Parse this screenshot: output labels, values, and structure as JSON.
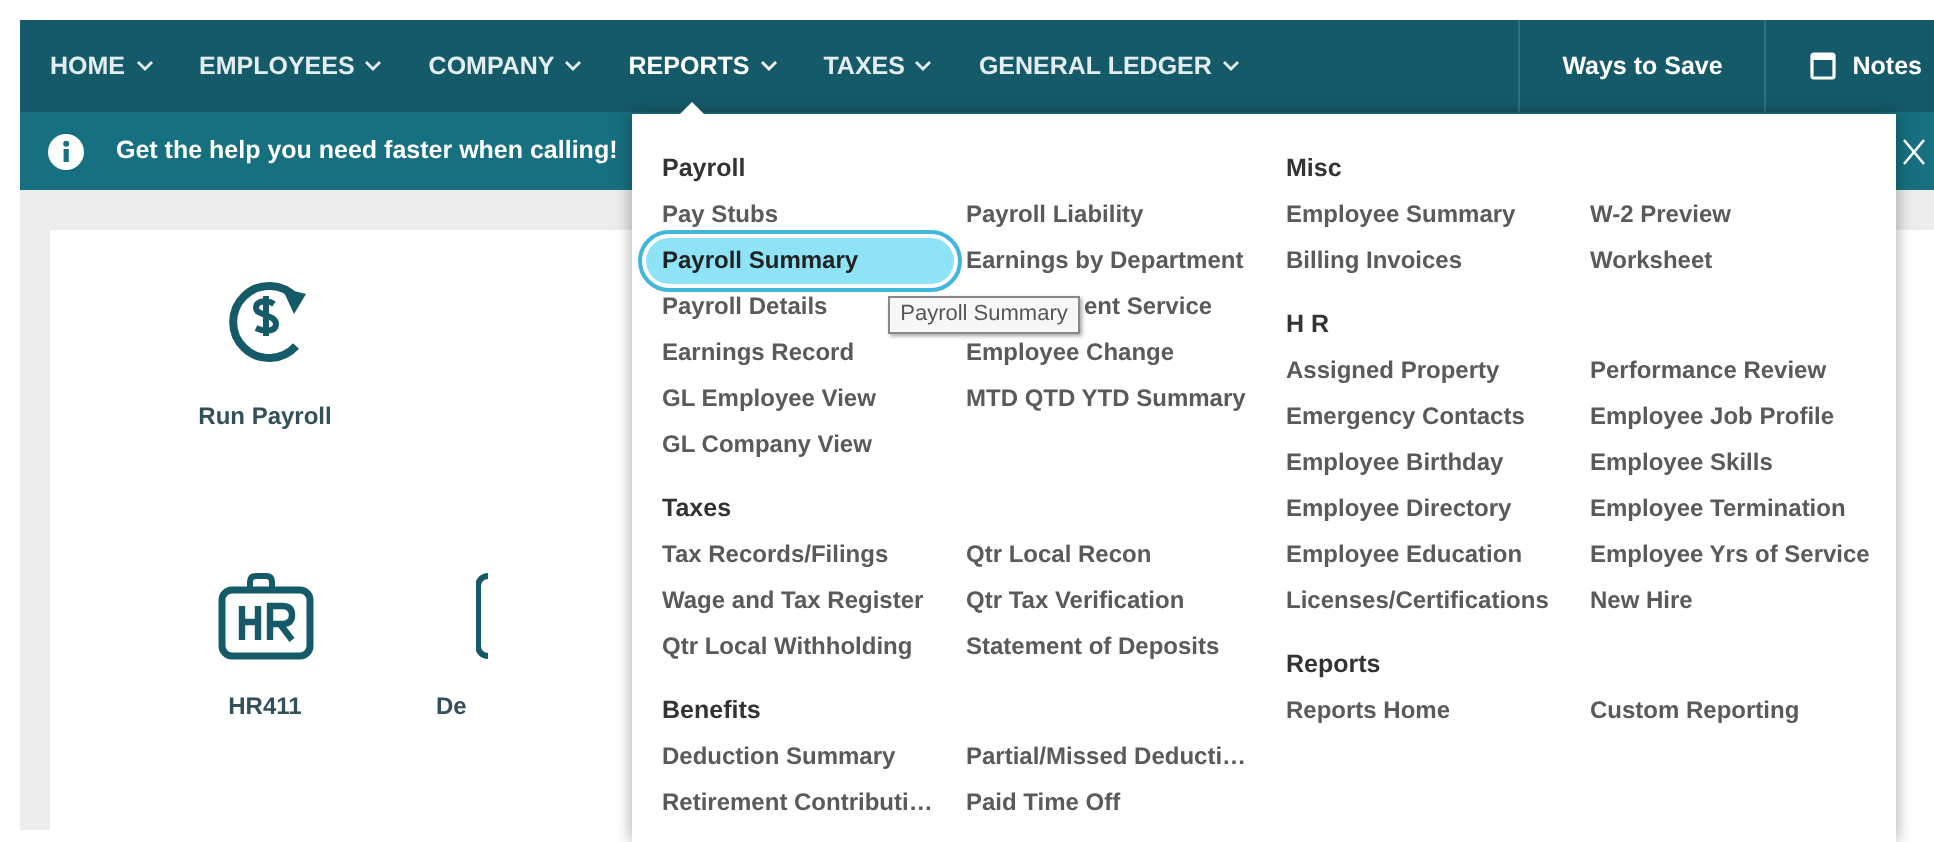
{
  "nav": {
    "items": [
      {
        "label": "HOME",
        "selected": false
      },
      {
        "label": "EMPLOYEES",
        "selected": false
      },
      {
        "label": "COMPANY",
        "selected": false
      },
      {
        "label": "REPORTS",
        "selected": true
      },
      {
        "label": "TAXES",
        "selected": false
      },
      {
        "label": "GENERAL LEDGER",
        "selected": false
      }
    ],
    "ways_to_save": "Ways to Save",
    "notes": "Notes"
  },
  "banner": {
    "text": "Get the help you need faster when calling!"
  },
  "tiles": [
    {
      "label": "Run Payroll",
      "kind": "payroll"
    },
    {
      "label": "HR411",
      "kind": "hr"
    },
    {
      "label": "De",
      "kind": "partial"
    }
  ],
  "dropdown": {
    "columns": [
      [
        {
          "title": "Payroll",
          "items": [
            {
              "label": "Pay Stubs",
              "selected": false
            },
            {
              "label": "Payroll Liability",
              "selected": false
            },
            {
              "label": "Payroll Summary",
              "selected": true
            },
            {
              "label": "Earnings by Department",
              "selected": false
            },
            {
              "label": "Payroll Details",
              "selected": false
            },
            {
              "label": "ent Service",
              "selected": false,
              "covered": true
            },
            {
              "label": "Earnings Record",
              "selected": false
            },
            {
              "label": "Employee Change",
              "selected": false
            },
            {
              "label": "GL Employee View",
              "selected": false
            },
            {
              "label": "MTD QTD YTD Summary",
              "selected": false
            },
            {
              "label": "GL Company View",
              "selected": false
            }
          ]
        },
        {
          "title": "Taxes",
          "items": [
            {
              "label": "Tax Records/Filings",
              "selected": false
            },
            {
              "label": "Qtr Local Recon",
              "selected": false
            },
            {
              "label": "Wage and Tax Register",
              "selected": false
            },
            {
              "label": "Qtr Tax Verification",
              "selected": false
            },
            {
              "label": "Qtr Local Withholding",
              "selected": false
            },
            {
              "label": "Statement of Deposits",
              "selected": false
            }
          ]
        },
        {
          "title": "Benefits",
          "items": [
            {
              "label": "Deduction Summary",
              "selected": false
            },
            {
              "label": "Partial/Missed Deducti…",
              "selected": false
            },
            {
              "label": "Retirement Contributi…",
              "selected": false
            },
            {
              "label": "Paid Time Off",
              "selected": false
            }
          ]
        }
      ],
      [
        {
          "title": "Misc",
          "items": [
            {
              "label": "Employee Summary",
              "selected": false
            },
            {
              "label": "W-2 Preview",
              "selected": false
            },
            {
              "label": "Billing Invoices",
              "selected": false
            },
            {
              "label": "Worksheet",
              "selected": false
            }
          ]
        },
        {
          "title": "H R",
          "items": [
            {
              "label": "Assigned Property",
              "selected": false
            },
            {
              "label": "Performance Review",
              "selected": false
            },
            {
              "label": "Emergency Contacts",
              "selected": false
            },
            {
              "label": "Employee Job Profile",
              "selected": false
            },
            {
              "label": "Employee Birthday",
              "selected": false
            },
            {
              "label": "Employee Skills",
              "selected": false
            },
            {
              "label": "Employee Directory",
              "selected": false
            },
            {
              "label": "Employee Termination",
              "selected": false
            },
            {
              "label": "Employee Education",
              "selected": false
            },
            {
              "label": "Employee Yrs of Service",
              "selected": false
            },
            {
              "label": "Licenses/Certifications",
              "selected": false
            },
            {
              "label": "New Hire",
              "selected": false
            }
          ]
        },
        {
          "title": "Reports",
          "items": [
            {
              "label": "Reports Home",
              "selected": false
            },
            {
              "label": "Custom Reporting",
              "selected": false
            }
          ]
        }
      ]
    ],
    "tooltip": "Payroll Summary"
  }
}
